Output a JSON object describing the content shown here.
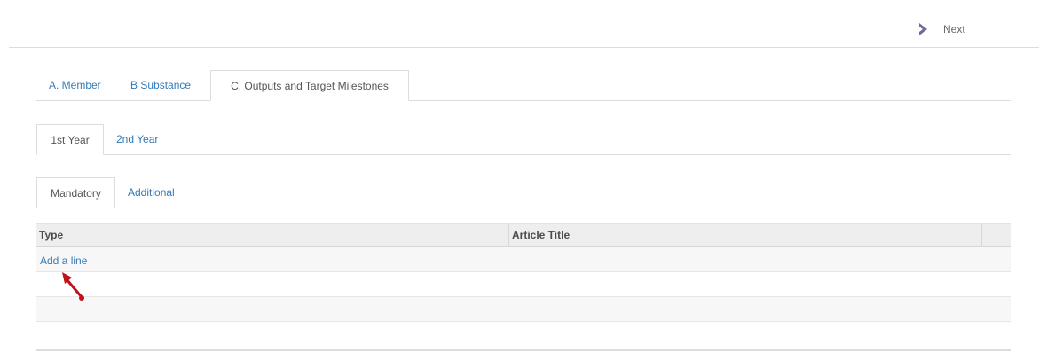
{
  "header": {
    "next_label": "Next"
  },
  "main_tabs": [
    {
      "label": "A. Member",
      "active": false
    },
    {
      "label": "B Substance",
      "active": false
    },
    {
      "label": "C. Outputs and Target Milestones",
      "active": true
    }
  ],
  "year_tabs": [
    {
      "label": "1st Year",
      "active": true
    },
    {
      "label": "2nd Year",
      "active": false
    }
  ],
  "sub_tabs": [
    {
      "label": "Mandatory",
      "active": true
    },
    {
      "label": "Additional",
      "active": false
    }
  ],
  "table": {
    "columns": [
      "Type",
      "Article Title"
    ],
    "add_line_label": "Add a line"
  },
  "colors": {
    "link": "#337ab7",
    "annotation_arrow": "#c0121a",
    "header_bg": "#eeeeee"
  },
  "icons": {
    "next": "chevron-right-icon",
    "annotation": "red-arrow-pointer"
  }
}
